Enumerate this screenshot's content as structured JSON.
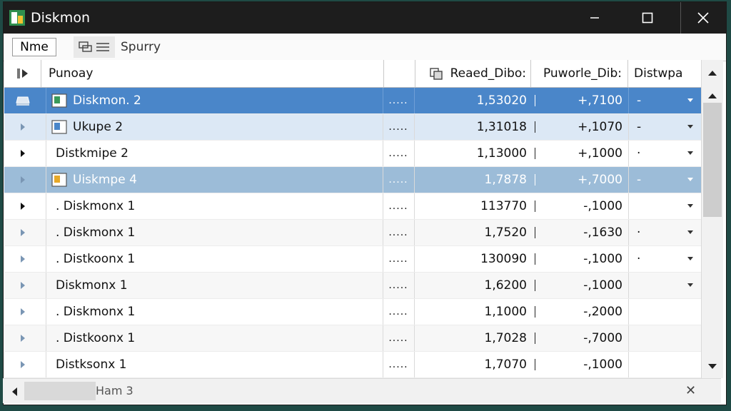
{
  "window": {
    "title": "Diskmon",
    "controls": {
      "minimize": "—",
      "maximize": "☐",
      "close": "✕"
    }
  },
  "toolbar": {
    "name_label": "Nme",
    "search_label": "Spurry"
  },
  "columns": {
    "name": "Punoay",
    "read": "Reaed_Dibo:",
    "write": "Puworle_Dib:",
    "dist": "Distwpa"
  },
  "rows": [
    {
      "name": "Diskmon. 2",
      "dots": ".....",
      "read": "1,53020",
      "write": "+,7100",
      "dist": "-",
      "style": "sel",
      "icon": "green-doc-icon",
      "has_dropdown": true
    },
    {
      "name": "Ukupe 2",
      "dots": ".....",
      "read": "1,31018",
      "write": "+,1070",
      "dist": "-",
      "style": "light",
      "icon": "blue-doc-icon",
      "has_dropdown": true
    },
    {
      "name": "Distkmipe 2",
      "dots": ".....",
      "read": "1,13000",
      "write": "+,1000",
      "dist": "·",
      "style": "plain",
      "icon": "",
      "has_dropdown": true
    },
    {
      "name": "Uiskmpe 4",
      "dots": ".....",
      "read": "1,7878",
      "write": "+,7000",
      "dist": "-",
      "style": "mid",
      "icon": "yellow-doc-icon",
      "has_dropdown": true
    },
    {
      "name": ". Diskmonx 1",
      "dots": ".....",
      "read": "113770",
      "write": "-,1000",
      "dist": "",
      "style": "plain",
      "icon": "",
      "has_dropdown": true
    },
    {
      "name": ". Diskmonx 1",
      "dots": ".....",
      "read": "1,7520",
      "write": "-,1630",
      "dist": "·",
      "style": "alt",
      "icon": "",
      "has_dropdown": true
    },
    {
      "name": ". Distkoonx 1",
      "dots": ".....",
      "read": "130090",
      "write": "-,1000",
      "dist": "·",
      "style": "plain",
      "icon": "",
      "has_dropdown": true
    },
    {
      "name": "Diskmonx 1",
      "dots": ".....",
      "read": "1,6200",
      "write": "-,1000",
      "dist": "",
      "style": "alt",
      "icon": "",
      "has_dropdown": true
    },
    {
      "name": ". Diskmonx 1",
      "dots": ".....",
      "read": "1,1000",
      "write": "-,2000",
      "dist": "",
      "style": "plain",
      "icon": "",
      "has_dropdown": false
    },
    {
      "name": ". Distkoonx 1",
      "dots": ".....",
      "read": "1,7028",
      "write": "-,7000",
      "dist": "",
      "style": "alt",
      "icon": "",
      "has_dropdown": false
    },
    {
      "name": "Distksonx 1",
      "dots": ".....",
      "read": "1,7070",
      "write": "-,1000",
      "dist": "",
      "style": "plain",
      "icon": "",
      "has_dropdown": false
    }
  ],
  "statusbar": {
    "label": "Ham 3",
    "close": "✕"
  },
  "colors": {
    "selected_row": "#4a86c9",
    "light_row": "#dce8f5",
    "mid_row": "#9cbcd8",
    "titlebar": "#1d1d1d"
  }
}
